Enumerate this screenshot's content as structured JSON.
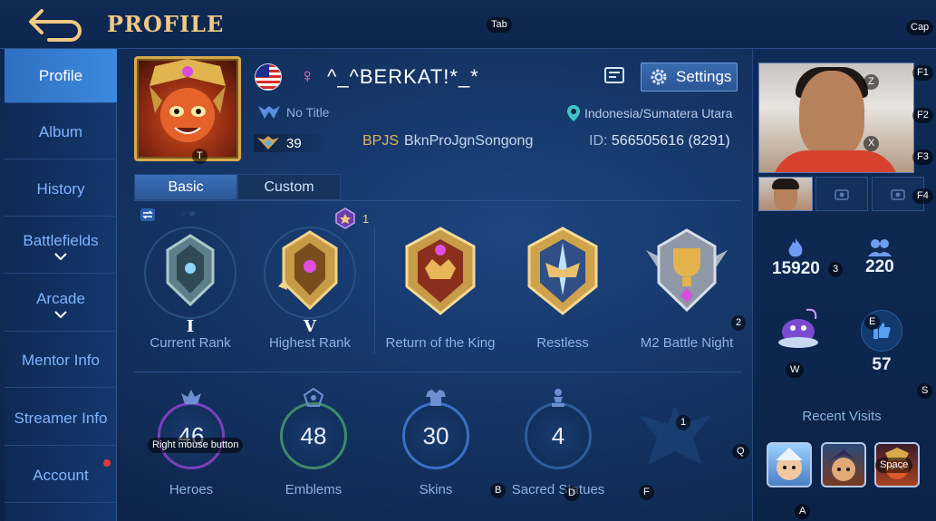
{
  "header": {
    "title": "PROFILE"
  },
  "key_hints": {
    "tab": "Tab",
    "cap": "Cap",
    "f1": "F1",
    "f2": "F2",
    "f3": "F3",
    "f4": "F4",
    "z": "Z",
    "x": "X",
    "t": "T",
    "n2": "2",
    "n3": "3",
    "e": "E",
    "w": "W",
    "s": "S",
    "n1": "1",
    "q": "Q",
    "b": "B",
    "d": "D",
    "f": "F",
    "a": "A",
    "space": "Space",
    "rmb": "Right mouse button"
  },
  "sidebar": {
    "items": [
      {
        "label": "Profile",
        "active": true
      },
      {
        "label": "Album"
      },
      {
        "label": "History"
      },
      {
        "label": "Battlefields",
        "expandable": true
      },
      {
        "label": "Arcade",
        "expandable": true
      },
      {
        "label": "Mentor Info"
      },
      {
        "label": "Streamer Info"
      },
      {
        "label": "Account",
        "notification": true
      }
    ]
  },
  "player": {
    "name": "^_^BERKAT!*_*",
    "gender_symbol": "♀",
    "title": "No Title",
    "location": "Indonesia/Sumatera Utara",
    "level": "39",
    "squad_tag": "BPJS",
    "squad_name": "BknProJgnSongong",
    "id_label": "ID:",
    "id_value": "566505616 (8291)"
  },
  "buttons": {
    "settings": "Settings"
  },
  "tabs": [
    {
      "label": "Basic",
      "active": true
    },
    {
      "label": "Custom",
      "active": false
    }
  ],
  "ranks": [
    {
      "label": "Current Rank",
      "tier": "I"
    },
    {
      "label": "Highest Rank",
      "tier": "V",
      "star_count": "1"
    },
    {
      "label": "Return of the King",
      "tier": ""
    },
    {
      "label": "Restless",
      "tier": ""
    },
    {
      "label": "M2 Battle Night",
      "tier": ""
    }
  ],
  "stats": [
    {
      "label": "Heroes",
      "value": "46"
    },
    {
      "label": "Emblems",
      "value": "48"
    },
    {
      "label": "Skins",
      "value": "30"
    },
    {
      "label": "Sacred Statues",
      "value": "4"
    }
  ],
  "right_panel": {
    "popularity": "15920",
    "followers": "220",
    "likes": "57",
    "recent_visits_title": "Recent Visits"
  },
  "colors": {
    "accent_gold": "#f0c983",
    "active_blue": "#3b8ae0",
    "label_blue": "#8eb2e3",
    "notification_red": "#e23b3b"
  }
}
